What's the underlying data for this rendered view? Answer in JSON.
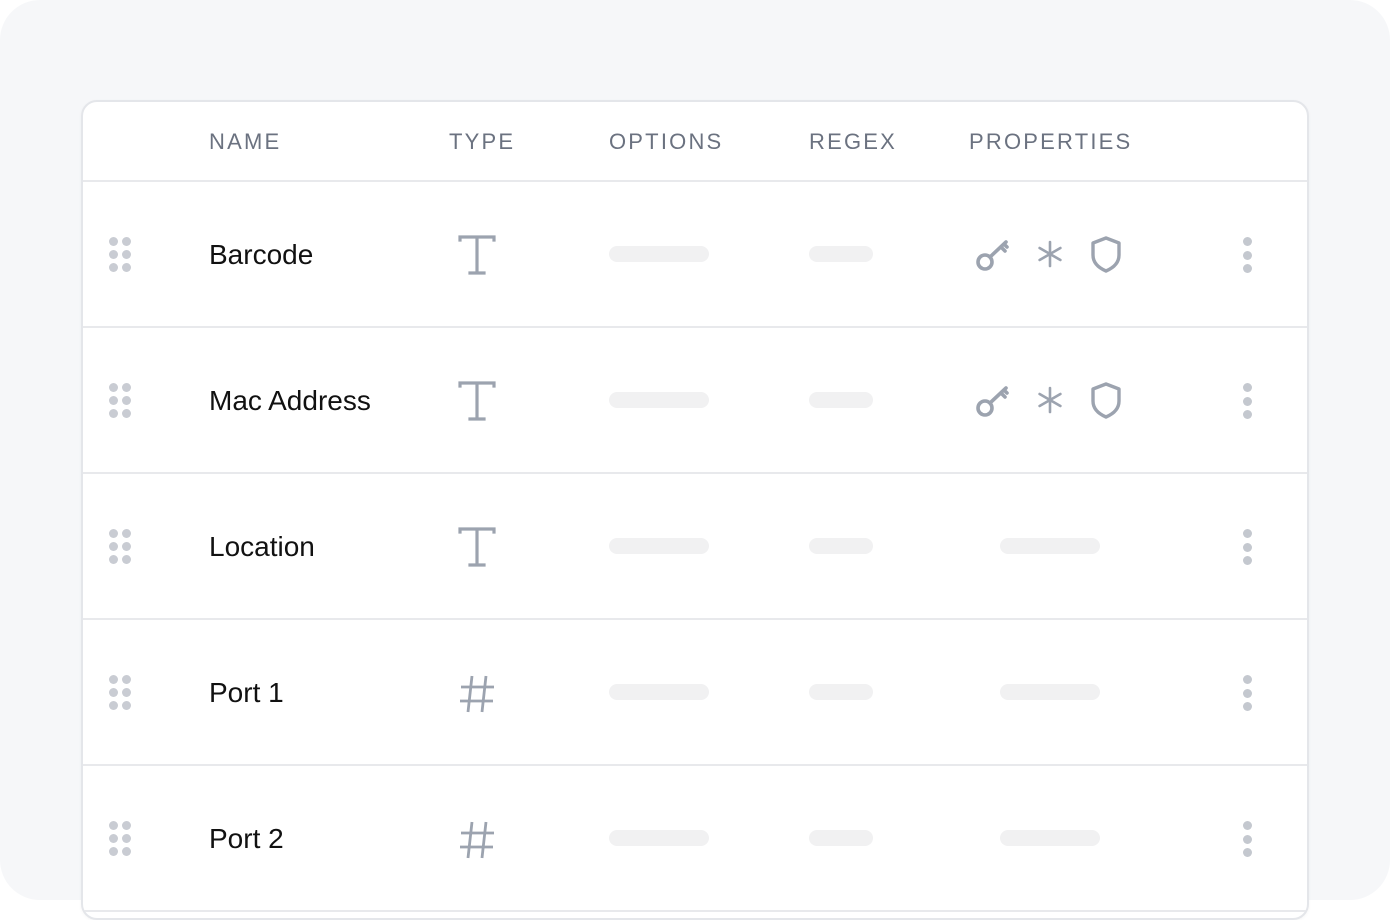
{
  "table": {
    "columns": [
      "NAME",
      "TYPE",
      "OPTIONS",
      "REGEX",
      "PROPERTIES"
    ],
    "rows": [
      {
        "name": "Barcode",
        "type_icon": "text-type-icon",
        "type_glyph": "T",
        "options": "placeholder",
        "regex": "placeholder",
        "properties": [
          "key-icon",
          "asterisk-icon",
          "shield-icon"
        ]
      },
      {
        "name": "Mac Address",
        "type_icon": "text-type-icon",
        "type_glyph": "T",
        "options": "placeholder",
        "regex": "placeholder",
        "properties": [
          "key-icon",
          "asterisk-icon",
          "shield-icon"
        ]
      },
      {
        "name": "Location",
        "type_icon": "text-type-icon",
        "type_glyph": "T",
        "options": "placeholder",
        "regex": "placeholder",
        "properties": "placeholder"
      },
      {
        "name": "Port 1",
        "type_icon": "number-type-icon",
        "type_glyph": "#",
        "options": "placeholder",
        "regex": "placeholder",
        "properties": "placeholder"
      },
      {
        "name": "Port 2",
        "type_icon": "number-type-icon",
        "type_glyph": "#",
        "options": "placeholder",
        "regex": "placeholder",
        "properties": "placeholder"
      }
    ]
  },
  "colors": {
    "background": "#f6f7f9",
    "card": "#ffffff",
    "border": "#e4e6ea",
    "header_text": "#6b7280",
    "name_text": "#111111",
    "icon": "#9ca3af",
    "placeholder": "#f1f1f2",
    "drag_handle": "#c9ccd3"
  }
}
